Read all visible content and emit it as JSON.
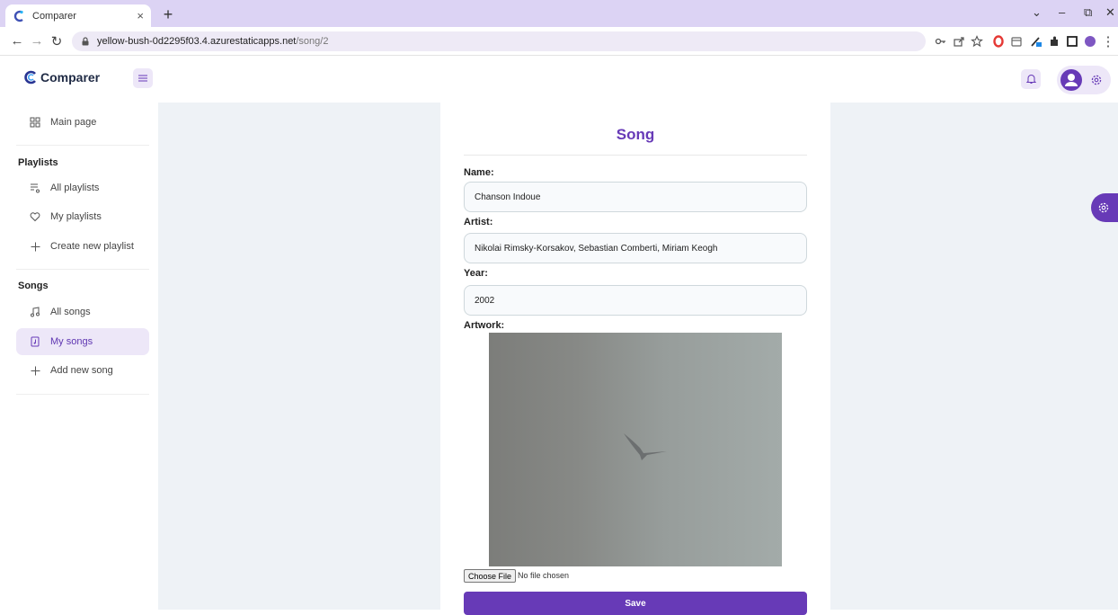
{
  "browser": {
    "tab_title": "Comparer",
    "tab_close": "×",
    "new_tab": "+",
    "url_host": "yellow-bush-0d2295f03.4.azurestaticapps.net",
    "url_path": "/song/2",
    "window_controls": [
      "⌄",
      "–",
      "⧉",
      "✕"
    ]
  },
  "header": {
    "logo_text": "Comparer"
  },
  "sidebar": {
    "main_page": "Main page",
    "playlists_section": "Playlists",
    "all_playlists": "All playlists",
    "my_playlists": "My playlists",
    "create_playlist": "Create new playlist",
    "songs_section": "Songs",
    "all_songs": "All songs",
    "my_songs": "My songs",
    "add_song": "Add new song"
  },
  "form": {
    "title": "Song",
    "name_label": "Name:",
    "name_value": "Chanson Indoue",
    "artist_label": "Artist:",
    "artist_value": "Nikolai Rimsky-Korsakov, Sebastian Comberti, Miriam Keogh",
    "year_label": "Year:",
    "year_value": "2002",
    "artwork_label": "Artwork:",
    "choose_file": "Choose File",
    "file_status": "No file chosen",
    "save": "Save"
  },
  "colors": {
    "accent": "#673ab7",
    "accent_light": "#ede7f8",
    "background": "#eef2f6"
  }
}
